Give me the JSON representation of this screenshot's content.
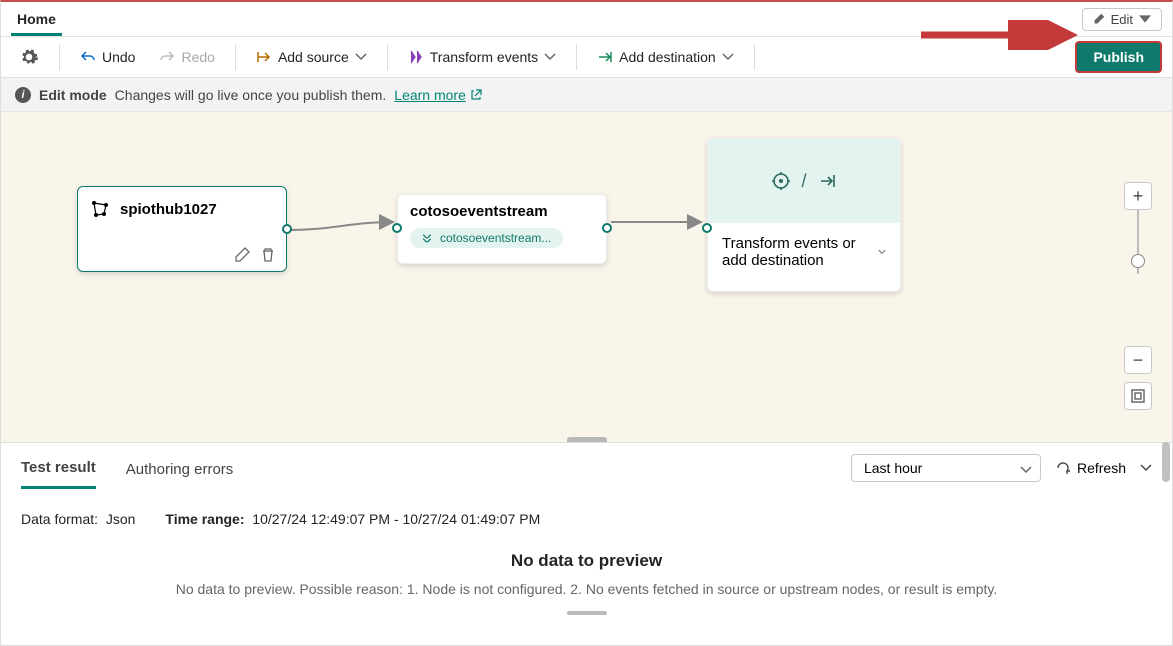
{
  "topbar": {
    "home": "Home",
    "edit": "Edit"
  },
  "toolbar": {
    "undo": "Undo",
    "redo": "Redo",
    "add_source": "Add source",
    "transform": "Transform events",
    "add_dest": "Add destination",
    "publish": "Publish"
  },
  "infobar": {
    "mode": "Edit mode",
    "msg": "Changes will go live once you publish them.",
    "learn": "Learn more"
  },
  "nodes": {
    "source": {
      "name": "spiothub1027"
    },
    "stream": {
      "name": "cotosoeventstream",
      "pill": "cotosoeventstream..."
    },
    "dest": {
      "label": "Transform events or add destination"
    }
  },
  "results": {
    "tabs": {
      "test": "Test result",
      "err": "Authoring errors"
    },
    "range_select": "Last hour",
    "refresh": "Refresh",
    "format_label": "Data format:",
    "format_value": "Json",
    "range_label": "Time range:",
    "range_value": "10/27/24 12:49:07 PM - 10/27/24 01:49:07 PM",
    "nodata_title": "No data to preview",
    "nodata_msg": "No data to preview. Possible reason: 1. Node is not configured. 2. No events fetched in source or upstream nodes, or result is empty."
  }
}
